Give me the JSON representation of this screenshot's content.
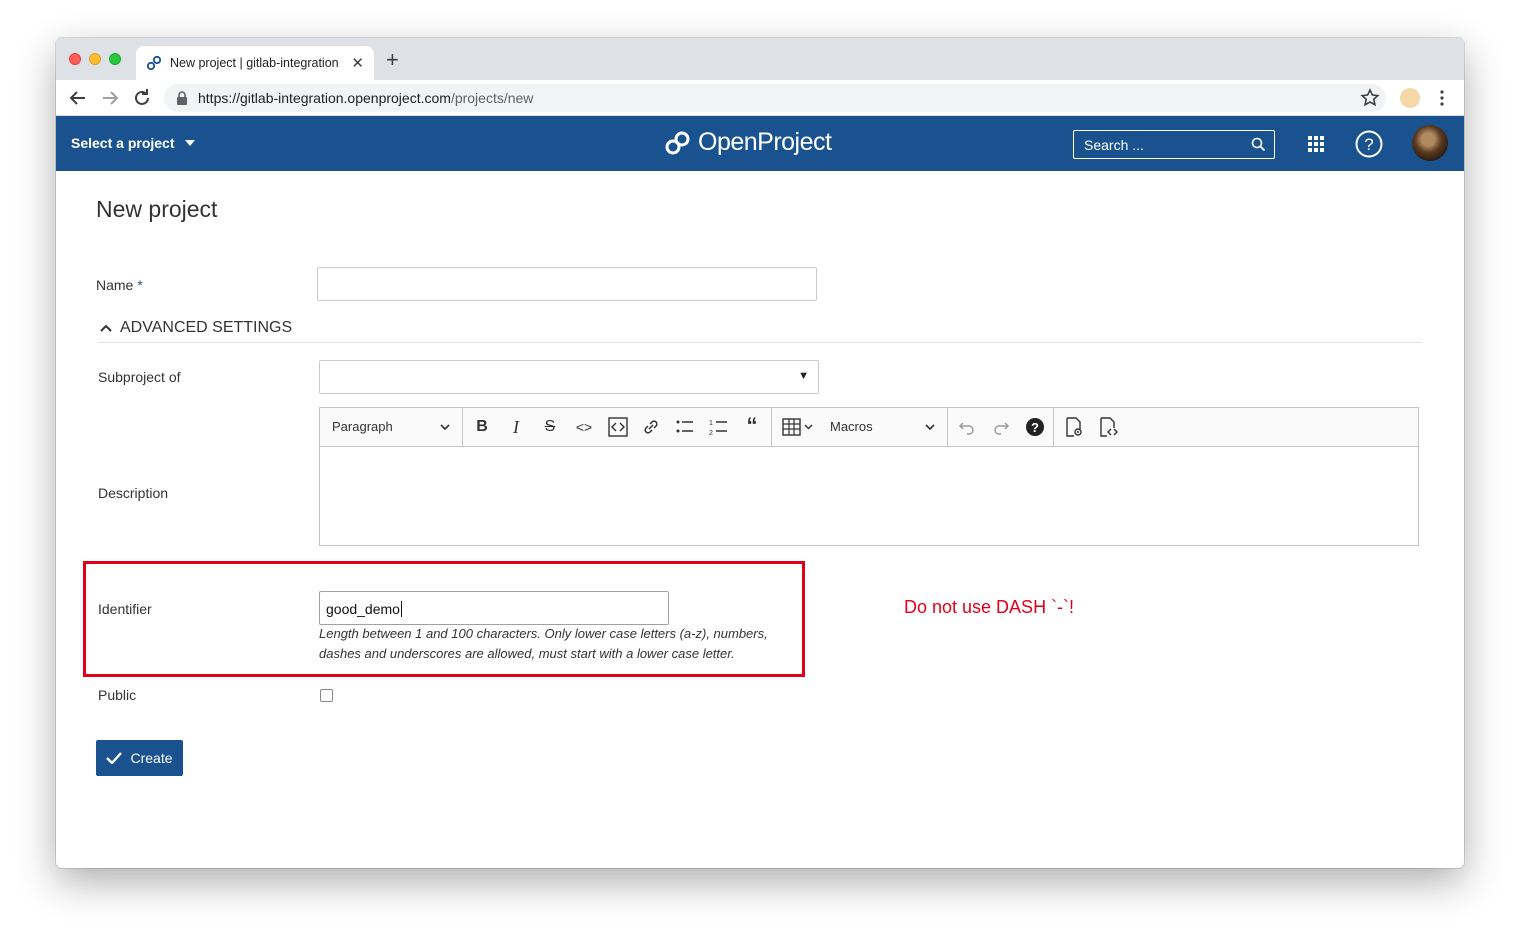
{
  "browser": {
    "tab_title": "New project | gitlab-integration",
    "new_tab_label": "+",
    "url_host": "https://gitlab-integration.openproject.com",
    "url_path": "/projects/new"
  },
  "header": {
    "project_select_label": "Select a project",
    "logo_text": "OpenProject",
    "search_placeholder": "Search ..."
  },
  "page": {
    "title": "New project",
    "name_label": "Name",
    "required_mark": "*",
    "name_value": "",
    "advanced_settings_label": "ADVANCED SETTINGS",
    "subproject_label": "Subproject of",
    "subproject_value": "",
    "description_label": "Description",
    "editor": {
      "paragraph_dropdown": "Paragraph",
      "macros_dropdown": "Macros"
    },
    "identifier_label": "Identifier",
    "identifier_value": "good_demo",
    "identifier_help": "Length between 1 and 100 characters. Only lower case letters (a-z), numbers, dashes and underscores are allowed, must start with a lower case letter.",
    "public_label": "Public",
    "public_checked": false,
    "create_button_label": "Create"
  },
  "annotation": {
    "text": "Do not use DASH `-`!",
    "color": "#e0001b"
  },
  "colors": {
    "brand": "#1a5290"
  }
}
